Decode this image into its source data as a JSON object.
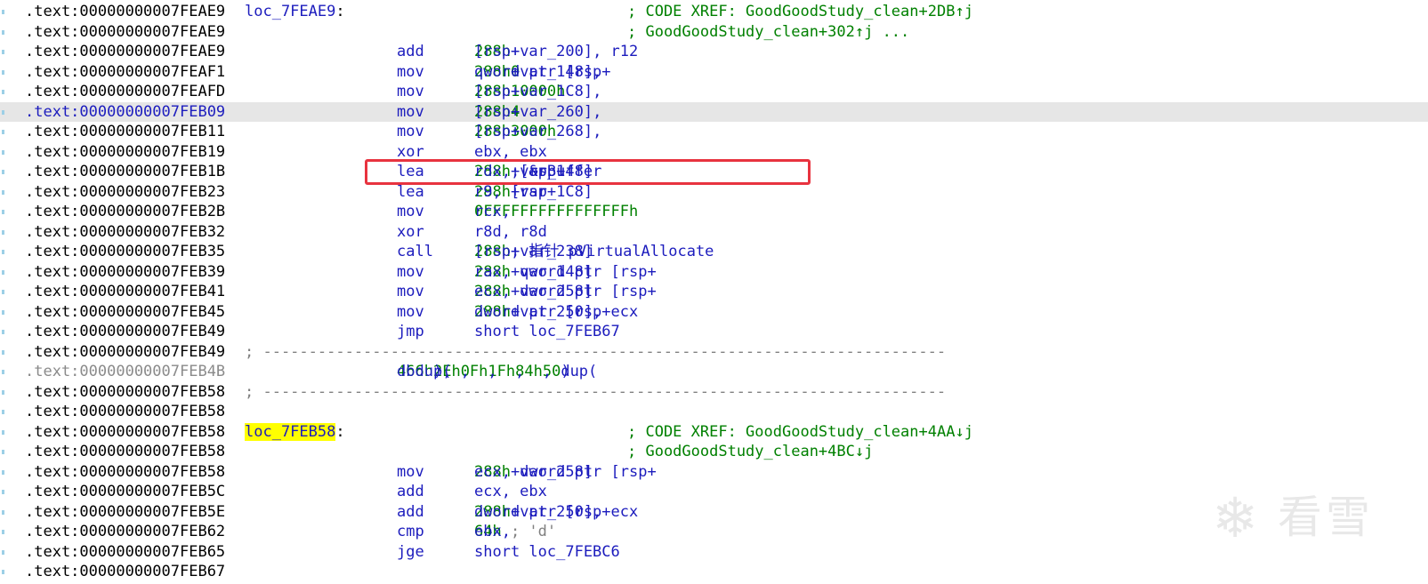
{
  "lines": [
    {
      "addr": ".text:00000000007FEAE9",
      "label": "loc_7FEAE9",
      "xref": "; CODE XREF: GoodGoodStudy_clean+2DB↑j"
    },
    {
      "addr": ".text:00000000007FEAE9",
      "xref": "; GoodGoodStudy_clean+302↑j ..."
    },
    {
      "addr": ".text:00000000007FEAE9",
      "mnem": "add",
      "ops": [
        {
          "t": "[rsp+"
        },
        {
          "t": "288h",
          "c": "num"
        },
        {
          "t": "+var_200], r12"
        }
      ]
    },
    {
      "addr": ".text:00000000007FEAF1",
      "mnem": "mov",
      "ops": [
        {
          "t": "qword ptr [rsp+"
        },
        {
          "t": "288h",
          "c": "num"
        },
        {
          "t": "+var_148], "
        },
        {
          "t": "0",
          "c": "num"
        }
      ]
    },
    {
      "addr": ".text:00000000007FEAFD",
      "mnem": "mov",
      "ops": [
        {
          "t": "[rsp+"
        },
        {
          "t": "288h",
          "c": "num"
        },
        {
          "t": "+var_1C8], "
        },
        {
          "t": "10000h",
          "c": "num"
        }
      ]
    },
    {
      "addr": ".text:00000000007FEB09",
      "mnem": "mov",
      "current": true,
      "ops": [
        {
          "t": "[rsp+"
        },
        {
          "t": "288h",
          "c": "num"
        },
        {
          "t": "+var_260], "
        },
        {
          "t": "4",
          "c": "num"
        }
      ]
    },
    {
      "addr": ".text:00000000007FEB11",
      "mnem": "mov",
      "ops": [
        {
          "t": "[rsp+"
        },
        {
          "t": "288h",
          "c": "num"
        },
        {
          "t": "+var_268], "
        },
        {
          "t": "3000h",
          "c": "num"
        }
      ]
    },
    {
      "addr": ".text:00000000007FEB19",
      "mnem": "xor",
      "ops": [
        {
          "t": "ebx, ebx"
        }
      ]
    },
    {
      "addr": ".text:00000000007FEB1B",
      "mnem": "lea",
      "ops": [
        {
          "t": "rdx, [rsp+"
        },
        {
          "t": "288h",
          "c": "num"
        },
        {
          "t": "+var_148] "
        },
        {
          "t": "; &pBuffer",
          "c": "cm"
        }
      ]
    },
    {
      "addr": ".text:00000000007FEB23",
      "mnem": "lea",
      "ops": [
        {
          "t": "r9, [rsp+"
        },
        {
          "t": "288h",
          "c": "num"
        },
        {
          "t": "+var_1C8]"
        }
      ]
    },
    {
      "addr": ".text:00000000007FEB2B",
      "mnem": "mov",
      "ops": [
        {
          "t": "rcx, "
        },
        {
          "t": "0FFFFFFFFFFFFFFFFh",
          "c": "num"
        }
      ]
    },
    {
      "addr": ".text:00000000007FEB32",
      "mnem": "xor",
      "ops": [
        {
          "t": "r8d, r8d"
        }
      ]
    },
    {
      "addr": ".text:00000000007FEB35",
      "mnem": "call",
      "ops": [
        {
          "t": "[rsp+"
        },
        {
          "t": "288h",
          "c": "num"
        },
        {
          "t": "+var_238] "
        },
        {
          "t": "; 指针 pVirtualAllocate",
          "c": "cm"
        }
      ]
    },
    {
      "addr": ".text:00000000007FEB39",
      "mnem": "mov",
      "ops": [
        {
          "t": "rax, qword ptr [rsp+"
        },
        {
          "t": "288h",
          "c": "num"
        },
        {
          "t": "+var_148]"
        }
      ]
    },
    {
      "addr": ".text:00000000007FEB41",
      "mnem": "mov",
      "ops": [
        {
          "t": "ecx, dword ptr [rsp+"
        },
        {
          "t": "288h",
          "c": "num"
        },
        {
          "t": "+var_258]"
        }
      ]
    },
    {
      "addr": ".text:00000000007FEB45",
      "mnem": "mov",
      "ops": [
        {
          "t": "dword ptr [rsp+"
        },
        {
          "t": "288h",
          "c": "num"
        },
        {
          "t": "+var_250], ecx"
        }
      ]
    },
    {
      "addr": ".text:00000000007FEB49",
      "mnem": "jmp",
      "ops": [
        {
          "t": "short loc_7FEB67"
        }
      ]
    },
    {
      "addr": ".text:00000000007FEB49",
      "sep": "; ---------------------------------------------------------------------------"
    },
    {
      "addr": ".text:00000000007FEB4B",
      "gray": true,
      "db": [
        {
          "t": "db "
        },
        {
          "t": "4",
          "c": "num"
        },
        {
          "t": " dup("
        },
        {
          "t": "66h",
          "c": "num"
        },
        {
          "t": "), "
        },
        {
          "t": "2Eh",
          "c": "num"
        },
        {
          "t": ", "
        },
        {
          "t": "0Fh",
          "c": "num"
        },
        {
          "t": ", "
        },
        {
          "t": "1Fh",
          "c": "num"
        },
        {
          "t": ", "
        },
        {
          "t": "84h",
          "c": "num"
        },
        {
          "t": ", "
        },
        {
          "t": "5",
          "c": "num"
        },
        {
          "t": " dup("
        },
        {
          "t": "0",
          "c": "num"
        },
        {
          "t": ")"
        }
      ]
    },
    {
      "addr": ".text:00000000007FEB58",
      "sep": "; ---------------------------------------------------------------------------"
    },
    {
      "addr": ".text:00000000007FEB58"
    },
    {
      "addr": ".text:00000000007FEB58",
      "label": "loc_7FEB58",
      "labelHighlight": true,
      "xref": "; CODE XREF: GoodGoodStudy_clean+4AA↓j"
    },
    {
      "addr": ".text:00000000007FEB58",
      "xref": "; GoodGoodStudy_clean+4BC↓j"
    },
    {
      "addr": ".text:00000000007FEB58",
      "mnem": "mov",
      "ops": [
        {
          "t": "ecx, dword ptr [rsp+"
        },
        {
          "t": "288h",
          "c": "num"
        },
        {
          "t": "+var_258]"
        }
      ]
    },
    {
      "addr": ".text:00000000007FEB5C",
      "mnem": "add",
      "ops": [
        {
          "t": "ecx, ebx"
        }
      ]
    },
    {
      "addr": ".text:00000000007FEB5E",
      "mnem": "add",
      "ops": [
        {
          "t": "dword ptr [rsp+"
        },
        {
          "t": "288h",
          "c": "num"
        },
        {
          "t": "+var_250], ecx"
        }
      ]
    },
    {
      "addr": ".text:00000000007FEB62",
      "mnem": "cmp",
      "ops": [
        {
          "t": "ebx, "
        },
        {
          "t": "64h",
          "c": "num"
        },
        {
          "t": " ; 'd'",
          "c": "cmg"
        }
      ]
    },
    {
      "addr": ".text:00000000007FEB65",
      "mnem": "jge",
      "ops": [
        {
          "t": "short loc_7FEBC6"
        }
      ]
    },
    {
      "addr": ".text:00000000007FEB67"
    }
  ],
  "colon": ":",
  "watermark": {
    "icon": "snowflake-icon",
    "glyph": "❄",
    "text": "看雪"
  },
  "colors": {
    "highlight_box": "#e8333f",
    "label_highlight": "#ffff00",
    "current_line": "#e6e6e6"
  }
}
